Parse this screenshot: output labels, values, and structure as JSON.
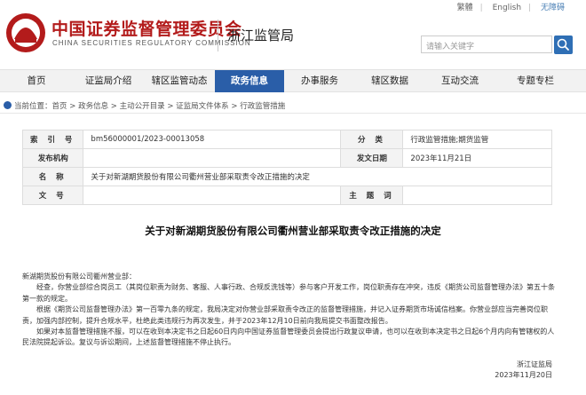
{
  "header": {
    "org_cn": "中国证券监督管理委员会",
    "org_en": "CHINA SECURITIES REGULATORY COMMISSION",
    "bureau": "浙江监管局",
    "top_links": [
      "繁體",
      "English",
      "无障碍"
    ],
    "search_placeholder": "请输入关键字",
    "brand_color": "#b31b1b",
    "accent_color": "#2a5ea8"
  },
  "nav": {
    "items": [
      "首页",
      "证监局介绍",
      "辖区监管动态",
      "政务信息",
      "办事服务",
      "辖区数据",
      "互动交流",
      "专题专栏"
    ],
    "active": "政务信息"
  },
  "breadcrumb": {
    "label": "当前位置：",
    "items": [
      "首页",
      "政务信息",
      "主动公开目录",
      "证监局文件体系",
      "行政监管措施"
    ]
  },
  "meta": {
    "index_label": "索 引 号",
    "index_value": "bm56000001/2023-00013058",
    "category_label": "分 类",
    "category_value": "行政监管措施;期货监管",
    "publisher_label": "发布机构",
    "publisher_value": "",
    "date_label": "发文日期",
    "date_value": "2023年11月21日",
    "name_label": "名 称",
    "name_value": "关于对新湖期货股份有限公司衢州营业部采取责令改正措施的决定",
    "docno_label": "文 号",
    "docno_value": "",
    "subject_label": "主 题 词",
    "subject_value": ""
  },
  "document": {
    "title": "关于对新湖期货股份有限公司衢州营业部采取责令改正措施的决定",
    "salutation": "新湖期货股份有限公司衢州营业部：",
    "para1": "经查，你营业部综合岗员工（其岗位职责为财务、客服、人事行政、合规反洗钱等）参与客户开发工作，岗位职责存在冲突，违反《期货公司监督管理办法》第五十条第一款的规定。",
    "para2": "根据《期货公司监督管理办法》第一百零九条的规定，我局决定对你营业部采取责令改正的监督管理措施，并记入证券期货市场诚信档案。你营业部应当完善岗位职责，加强内部控制，提升合规水平，杜绝此类违规行为再次发生，并于2023年12月10日前向我局提交书面整改报告。",
    "para3": "如果对本监督管理措施不服，可以在收到本决定书之日起60日内向中国证券监督管理委员会提出行政复议申请，也可以在收到本决定书之日起6个月内向有管辖权的人民法院提起诉讼。复议与诉讼期间，上述监督管理措施不停止执行。",
    "signer": "浙江证监局",
    "sign_date": "2023年11月20日"
  }
}
